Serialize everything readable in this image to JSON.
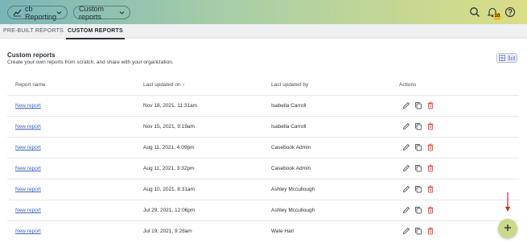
{
  "header": {
    "app_label": "cb Reporting",
    "selector_label": "Custom reports",
    "notification_count": "10"
  },
  "tabs": [
    {
      "label": "PRE-BUILT REPORTS",
      "active": false
    },
    {
      "label": "CUSTOM REPORTS",
      "active": true
    }
  ],
  "section": {
    "title": "Custom reports",
    "subtitle": "Create your own reports from scratch, and share with your organization."
  },
  "table": {
    "columns": [
      "Report name",
      "Last updated on",
      "Last updated by",
      "Actions"
    ],
    "sort_indicator": "↑",
    "rows": [
      {
        "name": "New report",
        "updated_on": "Nov 18, 2021, 11:31am",
        "updated_by": "Isabella Carroll"
      },
      {
        "name": "New report",
        "updated_on": "Nov 15, 2021, 9:19am",
        "updated_by": "Isabella Carroll"
      },
      {
        "name": "New report",
        "updated_on": "Aug 11, 2021, 4:09pm",
        "updated_by": "Casebook Admin"
      },
      {
        "name": "New report",
        "updated_on": "Aug 11, 2021, 3:32pm",
        "updated_by": "Casebook Admin"
      },
      {
        "name": "New report",
        "updated_on": "Aug 10, 2021, 8:31am",
        "updated_by": "Ashley Mccullough"
      },
      {
        "name": "New report",
        "updated_on": "Jul 29, 2021, 12:06pm",
        "updated_by": "Ashley Mccullough"
      },
      {
        "name": "New report",
        "updated_on": "Jul 19, 2021, 9:28am",
        "updated_by": "Wale Hari"
      }
    ]
  },
  "fab": {
    "icon": "plus-icon"
  },
  "colors": {
    "accent_gradient_start": "#79b6b8",
    "accent_gradient_end": "#d9de86",
    "delete_icon": "#d9534f",
    "link": "#3b62c4"
  }
}
